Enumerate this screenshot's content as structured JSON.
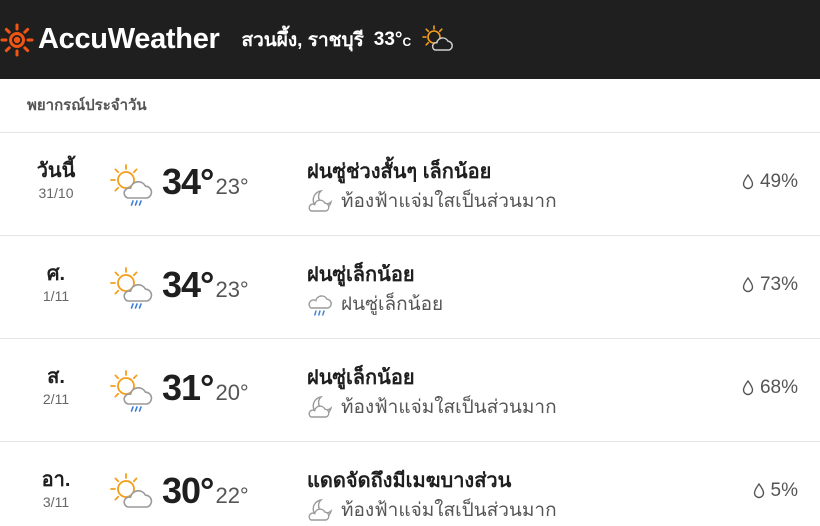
{
  "header": {
    "brand": "AccuWeather",
    "location": "สวนผึ้ง, ราชบุรี",
    "current_temp": "33°",
    "current_unit": "C",
    "current_icon": "partly-sunny-icon"
  },
  "daily": {
    "title": "พยากรณ์ประจำวัน",
    "days": [
      {
        "dow": "วันนี้",
        "date": "31/10",
        "high": "34°",
        "low": "23°",
        "icon": "sun-cloud-rain-icon",
        "phrase": "ฝนซู่ช่วงสั้นๆ เล็กน้อย",
        "night_icon": "moon-cloud-icon",
        "night": "ท้องฟ้าแจ่มใสเป็นส่วนมาก",
        "precip": "49%"
      },
      {
        "dow": "ศ.",
        "date": "1/11",
        "high": "34°",
        "low": "23°",
        "icon": "sun-cloud-rain-icon",
        "phrase": "ฝนซู่เล็กน้อย",
        "night_icon": "cloud-rain-icon",
        "night": "ฝนซู่เล็กน้อย",
        "precip": "73%"
      },
      {
        "dow": "ส.",
        "date": "2/11",
        "high": "31°",
        "low": "20°",
        "icon": "sun-cloud-rain-icon",
        "phrase": "ฝนซู่เล็กน้อย",
        "night_icon": "moon-cloud-icon",
        "night": "ท้องฟ้าแจ่มใสเป็นส่วนมาก",
        "precip": "68%"
      },
      {
        "dow": "อา.",
        "date": "3/11",
        "high": "30°",
        "low": "22°",
        "icon": "sun-cloud-icon",
        "phrase": "แดดจัดถึงมีเมฆบางส่วน",
        "night_icon": "moon-cloud-icon",
        "night": "ท้องฟ้าแจ่มใสเป็นส่วนมาก",
        "precip": "5%"
      }
    ]
  },
  "colors": {
    "brand_orange": "#f05514",
    "sun": "#f59e1b",
    "rain": "#3b7dd8",
    "header_bg": "#1f1f1f"
  }
}
